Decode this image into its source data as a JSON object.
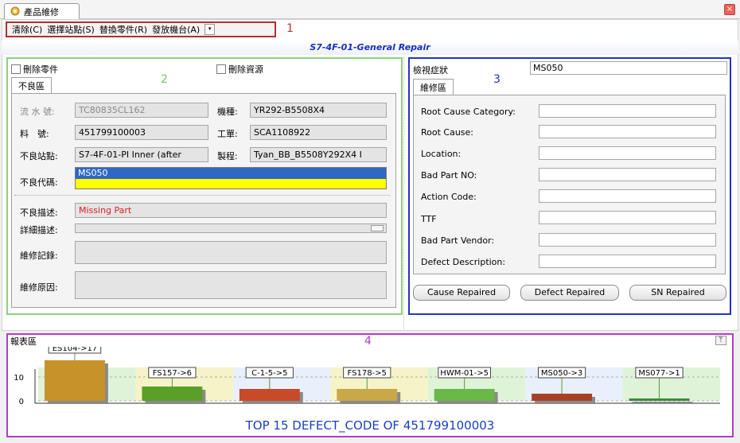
{
  "window": {
    "tab_title": "產品維修",
    "tab_icon": "gear-icon",
    "close_symbol": "×"
  },
  "toolbar": {
    "items": [
      "清除(C)",
      "選擇站點(S)",
      "替換零件(R)",
      "發放機台(A)"
    ],
    "dropdown_symbol": "▾"
  },
  "annotations": {
    "a1": "1",
    "a2": "2",
    "a3": "3",
    "a4": "4"
  },
  "header": {
    "title": "S7-4F-01-General Repair"
  },
  "left": {
    "delete_parts_label": "刪除零件",
    "delete_resource_label": "刪除資源",
    "tab_label": "不良區",
    "serial_label": "流 水 號:",
    "serial_value": "TC80835CL162",
    "model_label": "機種:",
    "model_value": "YR292-B5508X4",
    "part_label": "料　號:",
    "part_value": "451799100003",
    "work_order_label": "工單:",
    "work_order_value": "SCA1108922",
    "bad_station_label": "不良站點:",
    "bad_station_value": "S7-4F-01-PI Inner (after",
    "process_label": "製程:",
    "process_value": "Tyan_BB_B5508Y292X4 I",
    "bad_code_label": "不良代碼:",
    "bad_code_value": "MS050",
    "bad_desc_label": "不良描述:",
    "bad_desc_value": "Missing Part",
    "detail_desc_label": "詳細描述:",
    "repair_record_label": "維修記錄:",
    "repair_reason_label": "維修原因:"
  },
  "right": {
    "symptom_label": "檢視症狀",
    "symptom_value": "MS050",
    "tab_label": "維修區",
    "fields": [
      {
        "label": "Root Cause Category:",
        "value": ""
      },
      {
        "label": "Root Cause:",
        "value": ""
      },
      {
        "label": "Location:",
        "value": ""
      },
      {
        "label": "Bad Part NO:",
        "value": ""
      },
      {
        "label": "Action Code:",
        "value": ""
      },
      {
        "label": "TTF",
        "value": ""
      },
      {
        "label": "Bad Part Vendor:",
        "value": ""
      },
      {
        "label": "Defect Description:",
        "value": ""
      }
    ],
    "buttons": [
      "Cause Repaired",
      "Defect Repaired",
      "SN Repaired"
    ]
  },
  "report": {
    "label": "報表區",
    "pin_symbol": "ᛘ"
  },
  "chart_data": {
    "type": "bar",
    "title": "TOP 15 DEFECT_CODE OF 451799100003",
    "categories": [
      "ES104",
      "FS157",
      "C-1-5",
      "FS178",
      "HWM-01",
      "MS050",
      "MS077"
    ],
    "values": [
      17,
      6,
      5,
      5,
      5,
      3,
      1
    ],
    "data_labels": [
      "ES104->17",
      "FS157->6",
      "C-1-5->5",
      "FS178->5",
      "HWM-01->5",
      "MS050->3",
      "MS077->1"
    ],
    "yticks": [
      "10",
      "0"
    ],
    "ylim": [
      0,
      20
    ],
    "colors": [
      "#c8922a",
      "#5aa028",
      "#c84a28",
      "#c8a848",
      "#6ab848",
      "#a84028",
      "#3a8a3a"
    ],
    "grid": true,
    "legend": "none"
  }
}
